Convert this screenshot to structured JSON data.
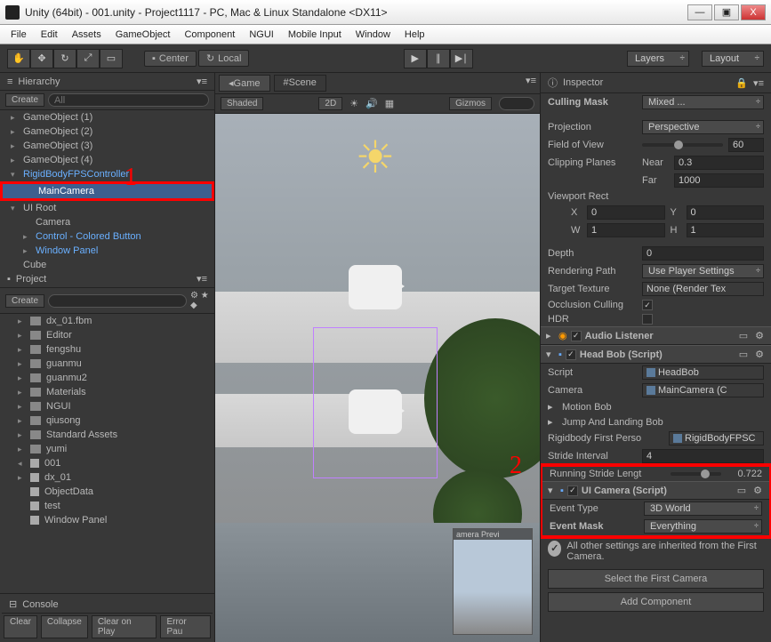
{
  "window": {
    "title": "Unity (64bit) - 001.unity - Project1117 - PC, Mac & Linux Standalone <DX11>",
    "min": "—",
    "max": "▣",
    "close": "X"
  },
  "menu": [
    "File",
    "Edit",
    "Assets",
    "GameObject",
    "Component",
    "NGUI",
    "Mobile Input",
    "Window",
    "Help"
  ],
  "toolbar": {
    "center": "Center",
    "local": "Local",
    "layers": "Layers",
    "layout": "Layout"
  },
  "hierarchy": {
    "title": "Hierarchy",
    "create": "Create ",
    "search_placeholder": "All",
    "items": [
      {
        "label": "GameObject (1)",
        "indent": 0,
        "arrow": "▸"
      },
      {
        "label": "GameObject (2)",
        "indent": 0,
        "arrow": "▸"
      },
      {
        "label": "GameObject (3)",
        "indent": 0,
        "arrow": "▸"
      },
      {
        "label": "GameObject (4)",
        "indent": 0,
        "arrow": "▸"
      },
      {
        "label": "RigidBodyFPSController",
        "indent": 0,
        "arrow": "▾",
        "highlighted": true
      },
      {
        "label": "MainCamera",
        "indent": 1,
        "arrow": "",
        "selected": true,
        "redbox": true
      },
      {
        "label": "UI Root",
        "indent": 0,
        "arrow": "▾"
      },
      {
        "label": "Camera",
        "indent": 1,
        "arrow": ""
      },
      {
        "label": "Control - Colored Button",
        "indent": 1,
        "arrow": "▸",
        "highlighted": true
      },
      {
        "label": "Window Panel",
        "indent": 1,
        "arrow": "▸",
        "highlighted": true
      },
      {
        "label": "Cube",
        "indent": 0,
        "arrow": ""
      }
    ]
  },
  "project": {
    "title": "Project",
    "create": "Create ",
    "items": [
      {
        "label": "dx_01.fbm",
        "icon": "folder",
        "arrow": "▸"
      },
      {
        "label": "Editor",
        "icon": "folder",
        "arrow": "▸"
      },
      {
        "label": "fengshu",
        "icon": "folder",
        "arrow": "▸"
      },
      {
        "label": "guanmu",
        "icon": "folder",
        "arrow": "▸"
      },
      {
        "label": "guanmu2",
        "icon": "folder",
        "arrow": "▸"
      },
      {
        "label": "Materials",
        "icon": "folder",
        "arrow": "▸"
      },
      {
        "label": "NGUI",
        "icon": "folder",
        "arrow": "▸"
      },
      {
        "label": "qiusong",
        "icon": "folder",
        "arrow": "▸"
      },
      {
        "label": "Standard Assets",
        "icon": "folder",
        "arrow": "▸"
      },
      {
        "label": "yumi",
        "icon": "folder",
        "arrow": "▸"
      },
      {
        "label": "001",
        "icon": "unity",
        "arrow": "◂"
      },
      {
        "label": "dx_01",
        "icon": "mesh",
        "arrow": "▸"
      },
      {
        "label": "ObjectData",
        "icon": "cube",
        "arrow": ""
      },
      {
        "label": "test",
        "icon": "cube",
        "arrow": ""
      },
      {
        "label": "Window Panel",
        "icon": "cube",
        "arrow": ""
      }
    ]
  },
  "console": {
    "title": "Console",
    "buttons": [
      "Clear",
      "Collapse",
      "Clear on Play",
      "Error Pau"
    ]
  },
  "scene": {
    "game_tab": "Game",
    "scene_tab": "Scene",
    "shaded": "Shaded",
    "mode2d": "2D",
    "gizmos": "Gizmos",
    "preview_label": "amera Previ"
  },
  "inspector": {
    "title": "Inspector",
    "culling_mask": {
      "label": "Culling Mask",
      "value": "Mixed ..."
    },
    "projection": {
      "label": "Projection",
      "value": "Perspective"
    },
    "fov": {
      "label": "Field of View",
      "value": "60"
    },
    "clipping": {
      "label": "Clipping Planes",
      "near_label": "Near",
      "near": "0.3",
      "far_label": "Far",
      "far": "1000"
    },
    "viewport": {
      "label": "Viewport Rect",
      "x_label": "X",
      "x": "0",
      "y_label": "Y",
      "y": "0",
      "w_label": "W",
      "w": "1",
      "h_label": "H",
      "h": "1"
    },
    "depth": {
      "label": "Depth",
      "value": "0"
    },
    "rendering_path": {
      "label": "Rendering Path",
      "value": "Use Player Settings"
    },
    "target_texture": {
      "label": "Target Texture",
      "value": "None (Render Tex"
    },
    "occlusion": {
      "label": "Occlusion Culling"
    },
    "hdr": {
      "label": "HDR"
    },
    "audio_listener": {
      "title": "Audio Listener"
    },
    "head_bob": {
      "title": "Head Bob (Script)",
      "script_label": "Script",
      "script": "HeadBob",
      "camera_label": "Camera",
      "camera": "MainCamera (C",
      "motion_bob": "Motion Bob",
      "jump_bob": "Jump And Landing Bob",
      "rigidbody_label": "Rigidbody First Perso",
      "rigidbody": "RigidBodyFPSC",
      "stride_label": "Stride Interval",
      "stride": "4",
      "running_label": "Running Stride Lengt",
      "running": "0.722"
    },
    "ui_camera": {
      "title": "UI Camera (Script)",
      "event_type_label": "Event Type",
      "event_type": "3D World",
      "event_mask_label": "Event Mask",
      "event_mask": "Everything"
    },
    "help_text": "All other settings are inherited from the First Camera.",
    "select_first": "Select the First Camera",
    "add_component": "Add Component"
  },
  "annotations": {
    "one": "1",
    "two": "2"
  }
}
